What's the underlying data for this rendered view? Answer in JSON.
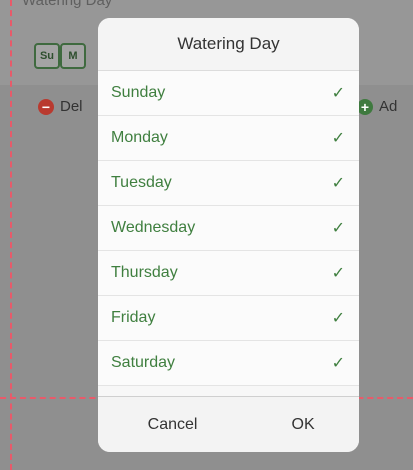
{
  "background": {
    "partial_title": "Watering Day",
    "day_chips": [
      "Su",
      "M"
    ],
    "delete_label": "Del",
    "add_label": "Ad"
  },
  "dialog": {
    "title": "Watering Day",
    "options": [
      {
        "label": "Sunday",
        "checked": true
      },
      {
        "label": "Monday",
        "checked": true
      },
      {
        "label": "Tuesday",
        "checked": true
      },
      {
        "label": "Wednesday",
        "checked": true
      },
      {
        "label": "Thursday",
        "checked": true
      },
      {
        "label": "Friday",
        "checked": true
      },
      {
        "label": "Saturday",
        "checked": true
      }
    ],
    "check_glyph": "✓",
    "cancel_label": "Cancel",
    "ok_label": "OK"
  },
  "colors": {
    "accent_green": "#3f7f3f",
    "delete_red": "#b93a2f",
    "guide_dash": "#e85a6a"
  }
}
